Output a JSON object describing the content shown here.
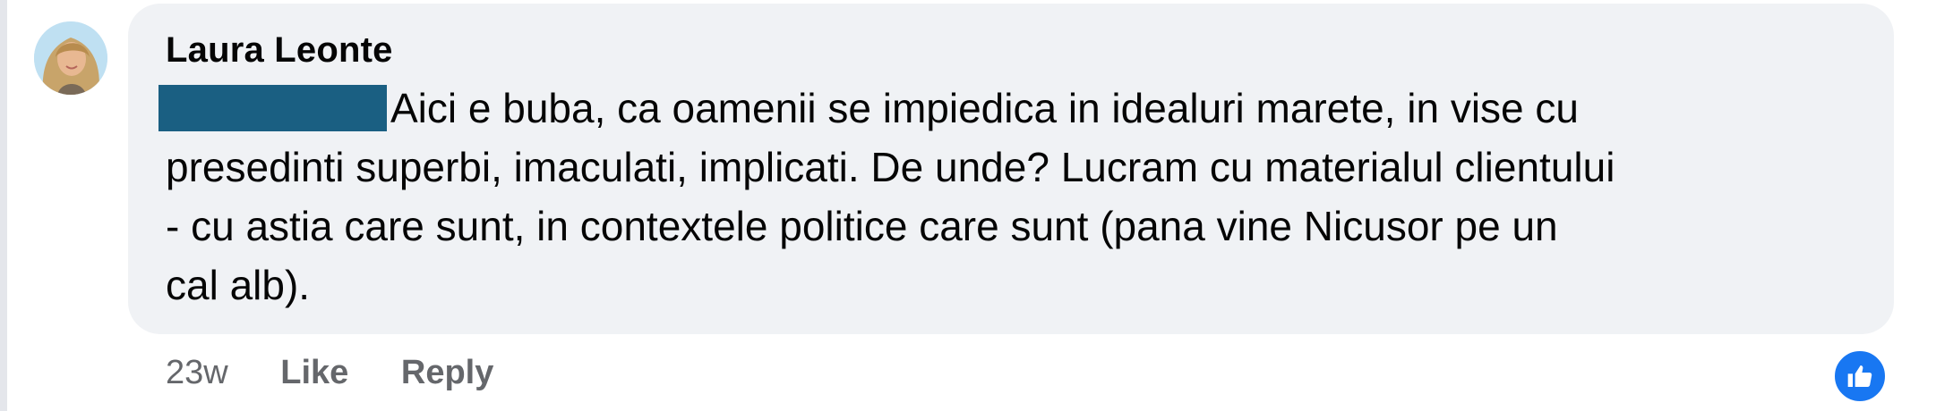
{
  "comment": {
    "author": "Laura Leonte",
    "lines": [
      "Aici e buba, ca oamenii se impiedica in idealuri marete, in vise cu",
      "presedinti superbi, imaculati, implicati. De unde? Lucram cu materialul clientului",
      "- cu astia care sunt, in contextele politice care sunt (pana vine Nicusor pe un",
      "cal alb)."
    ],
    "redacted_mention": true
  },
  "actions": {
    "timestamp": "23w",
    "like_label": "Like",
    "reply_label": "Reply"
  },
  "reaction": {
    "icon": "thumbs-up-icon",
    "color": "#1877f2"
  },
  "colors": {
    "bubble": "#f0f2f5",
    "redaction": "#1a5f82",
    "secondary_text": "#65676b"
  }
}
